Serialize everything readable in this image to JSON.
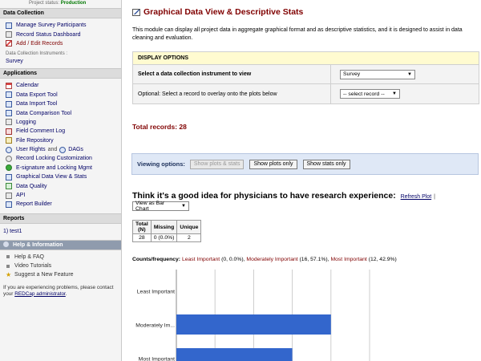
{
  "sidebar": {
    "project_status_label": "Project status:",
    "project_status_value": "Production",
    "data_collection": {
      "heading": "Data Collection",
      "items": [
        {
          "label": "Manage Survey Participants",
          "icon": "survey-participants-icon"
        },
        {
          "label": "Record Status Dashboard",
          "icon": "dashboard-icon"
        },
        {
          "label": "Add / Edit Records",
          "icon": "add-edit-records-icon"
        }
      ],
      "instruments_label": "Data Collection Instruments :",
      "instrument": "Survey"
    },
    "applications": {
      "heading": "Applications",
      "items": [
        {
          "label": "Calendar",
          "icon": "calendar-icon"
        },
        {
          "label": "Data Export Tool",
          "icon": "data-export-icon"
        },
        {
          "label": "Data Import Tool",
          "icon": "data-import-icon"
        },
        {
          "label": "Data Comparison Tool",
          "icon": "data-comparison-icon"
        },
        {
          "label": "Logging",
          "icon": "logging-icon"
        },
        {
          "label": "Field Comment Log",
          "icon": "field-comment-log-icon"
        },
        {
          "label": "File Repository",
          "icon": "file-repository-icon"
        },
        {
          "label": "User Rights",
          "and": "and",
          "extra": "DAGs",
          "icon": "user-rights-icon"
        },
        {
          "label": "Record Locking Customization",
          "icon": "record-locking-icon"
        },
        {
          "label": "E-signature and Locking Mgmt",
          "icon": "e-signature-icon"
        },
        {
          "label": "Graphical Data View & Stats",
          "icon": "graphical-data-icon"
        },
        {
          "label": "Data Quality",
          "icon": "data-quality-icon"
        },
        {
          "label": "API",
          "icon": "api-icon"
        },
        {
          "label": "Report Builder",
          "icon": "report-builder-icon"
        }
      ]
    },
    "reports": {
      "heading": "Reports",
      "items": [
        {
          "label": "1) test1"
        }
      ]
    },
    "help": {
      "heading": "Help & Information",
      "items": [
        {
          "label": "Help & FAQ"
        },
        {
          "label": "Video Tutorials"
        },
        {
          "label": "Suggest a New Feature",
          "icon": "star-icon"
        }
      ],
      "note_prefix": "If you are experiencing problems, please contact your",
      "note_link": "REDCap administrator",
      "note_suffix": "."
    }
  },
  "main": {
    "title": "Graphical Data View & Descriptive Stats",
    "intro": "This module can display all project data in aggregate graphical format and as descriptive statistics, and it is designed to assist in data cleaning and evaluation.",
    "display_options": {
      "heading": "DISPLAY OPTIONS",
      "instrument_label": "Select a data collection instrument to view",
      "instrument_value": "Survey",
      "record_label": "Optional: Select a record to overlay onto the plots below",
      "record_value": "-- select record --"
    },
    "total_records": "Total records: 28",
    "viewing_options": {
      "label": "Viewing options:",
      "buttons": [
        "Show plots & stats",
        "Show plots only",
        "Show stats only"
      ]
    },
    "question": {
      "title": "Think it's a good idea for physicians to have research experience:",
      "refresh": "Refresh Plot",
      "pipe": "|",
      "view_as": "View as Bar Chart",
      "stats_headers": [
        "Total (N)",
        "Missing",
        "Unique"
      ],
      "stats_values": [
        "28",
        "0 (0.0%)",
        "2"
      ],
      "counts_label": "Counts/frequency:",
      "counts": [
        {
          "category": "Least Important",
          "detail": "(0, 0.0%)"
        },
        {
          "category": "Moderately Important",
          "detail": "(16, 57.1%)"
        },
        {
          "category": "Most Important",
          "detail": "(12, 42.9%)"
        }
      ]
    }
  },
  "chart_data": {
    "type": "bar",
    "orientation": "horizontal",
    "categories": [
      "Least Important",
      "Moderately Im...",
      "Most Important"
    ],
    "values": [
      0,
      16,
      12
    ],
    "xlim": [
      0,
      20
    ],
    "grid": true,
    "color": "#3366cc"
  }
}
